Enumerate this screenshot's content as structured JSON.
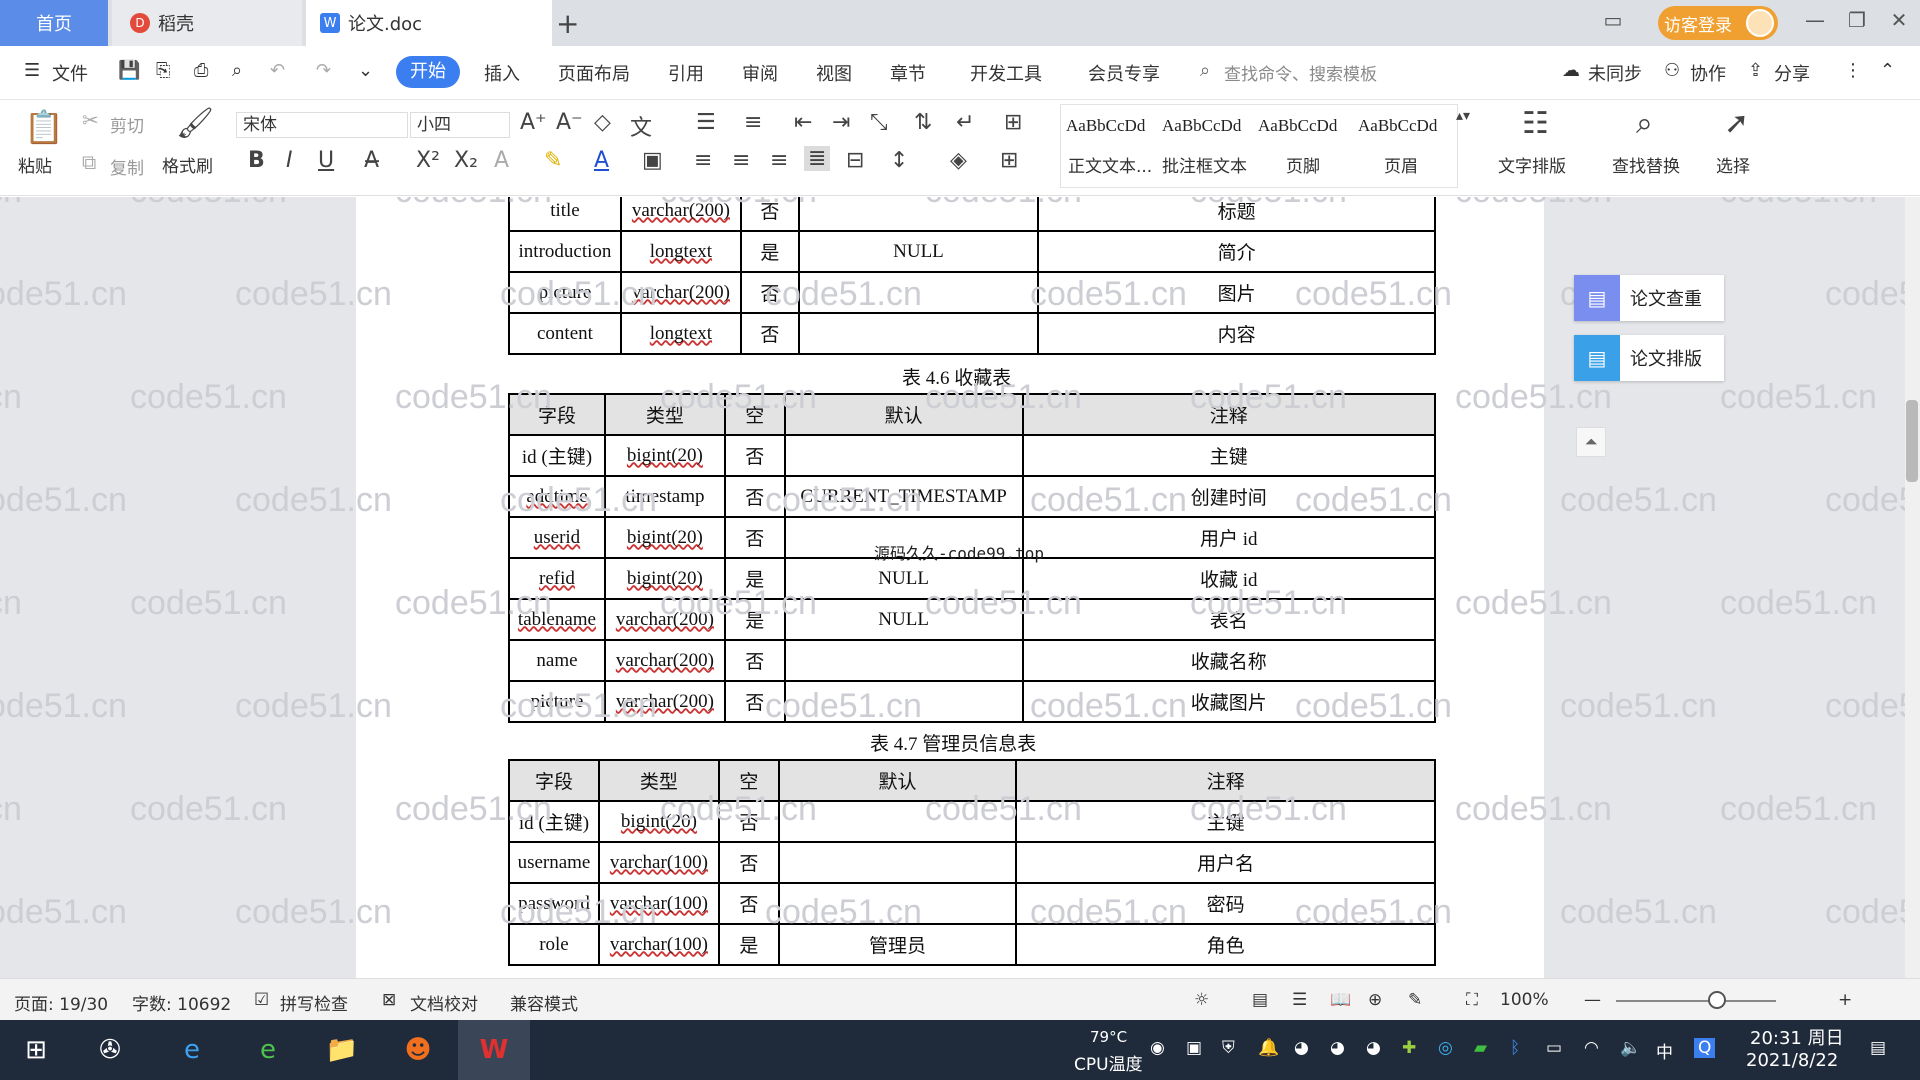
{
  "titlebar": {
    "home_tab": "首页",
    "daoke_tab": "稻壳",
    "doc_tab": "论文.doc",
    "login": "访客登录"
  },
  "menu": {
    "file": "文件",
    "start": "开始",
    "insert": "插入",
    "layout": "页面布局",
    "reference": "引用",
    "review": "审阅",
    "view": "视图",
    "chapter": "章节",
    "devtools": "开发工具",
    "member": "会员专享",
    "search": "查找命令、搜索模板",
    "sync": "未同步",
    "collab": "协作",
    "share": "分享"
  },
  "ribbon": {
    "paste": "粘贴",
    "cut": "剪切",
    "copy": "复制",
    "format_painter": "格式刷",
    "font": "宋体",
    "size": "小四",
    "styles": [
      {
        "preview": "AaBbCcDd",
        "name": "正文文本..."
      },
      {
        "preview": "AaBbCcDd",
        "name": "批注框文本"
      },
      {
        "preview": "AaBbCcDd",
        "name": "页脚"
      },
      {
        "preview": "AaBbCcDd",
        "name": "页眉"
      }
    ],
    "text_layout": "文字排版",
    "find_replace": "查找替换",
    "select": "选择"
  },
  "watermark": "code51.cn",
  "overlay_text": "源码久久-code99.top",
  "table_top": {
    "rows": [
      [
        "title",
        "varchar(200)",
        "否",
        "",
        "标题"
      ],
      [
        "introduction",
        "longtext",
        "是",
        "NULL",
        "简介"
      ],
      [
        "picture",
        "varchar(200)",
        "否",
        "",
        "图片"
      ],
      [
        "content",
        "longtext",
        "否",
        "",
        "内容"
      ]
    ]
  },
  "table_46": {
    "caption": "表 4.6  收藏表",
    "headers": [
      "字段",
      "类型",
      "空",
      "默认",
      "注释"
    ],
    "rows": [
      [
        "id (主键)",
        "bigint(20)",
        "否",
        "",
        "主键"
      ],
      [
        "addtime",
        "timestamp",
        "否",
        "CURRENT_TIMESTAMP",
        "创建时间"
      ],
      [
        "userid",
        "bigint(20)",
        "否",
        "",
        "用户 id"
      ],
      [
        "refid",
        "bigint(20)",
        "是",
        "NULL",
        "收藏 id"
      ],
      [
        "tablename",
        "varchar(200)",
        "是",
        "NULL",
        "表名"
      ],
      [
        "name",
        "varchar(200)",
        "否",
        "",
        "收藏名称"
      ],
      [
        "picture",
        "varchar(200)",
        "否",
        "",
        "收藏图片"
      ]
    ]
  },
  "table_47": {
    "caption": "表 4.7  管理员信息表",
    "headers": [
      "字段",
      "类型",
      "空",
      "默认",
      "注释"
    ],
    "rows": [
      [
        "id (主键)",
        "bigint(20)",
        "否",
        "",
        "主键"
      ],
      [
        "username",
        "varchar(100)",
        "否",
        "",
        "用户名"
      ],
      [
        "password",
        "varchar(100)",
        "否",
        "",
        "密码"
      ],
      [
        "role",
        "varchar(100)",
        "是",
        "管理员",
        "角色"
      ]
    ]
  },
  "side_panel": {
    "check": "论文查重",
    "format": "论文排版"
  },
  "status": {
    "page": "页面: 19/30",
    "words": "字数: 10692",
    "spell": "拼写检查",
    "proof": "文档校对",
    "compat": "兼容模式",
    "zoom": "100%"
  },
  "taskbar": {
    "cpu_temp": "79°C",
    "cpu_label": "CPU温度",
    "ime": "中",
    "time": "20:31 周日",
    "date": "2021/8/22"
  },
  "colors": {
    "accent": "#3b7ef0",
    "home_tab": "#5b8de8",
    "login": "#f0a030",
    "taskbar": "#1f2a3a"
  }
}
